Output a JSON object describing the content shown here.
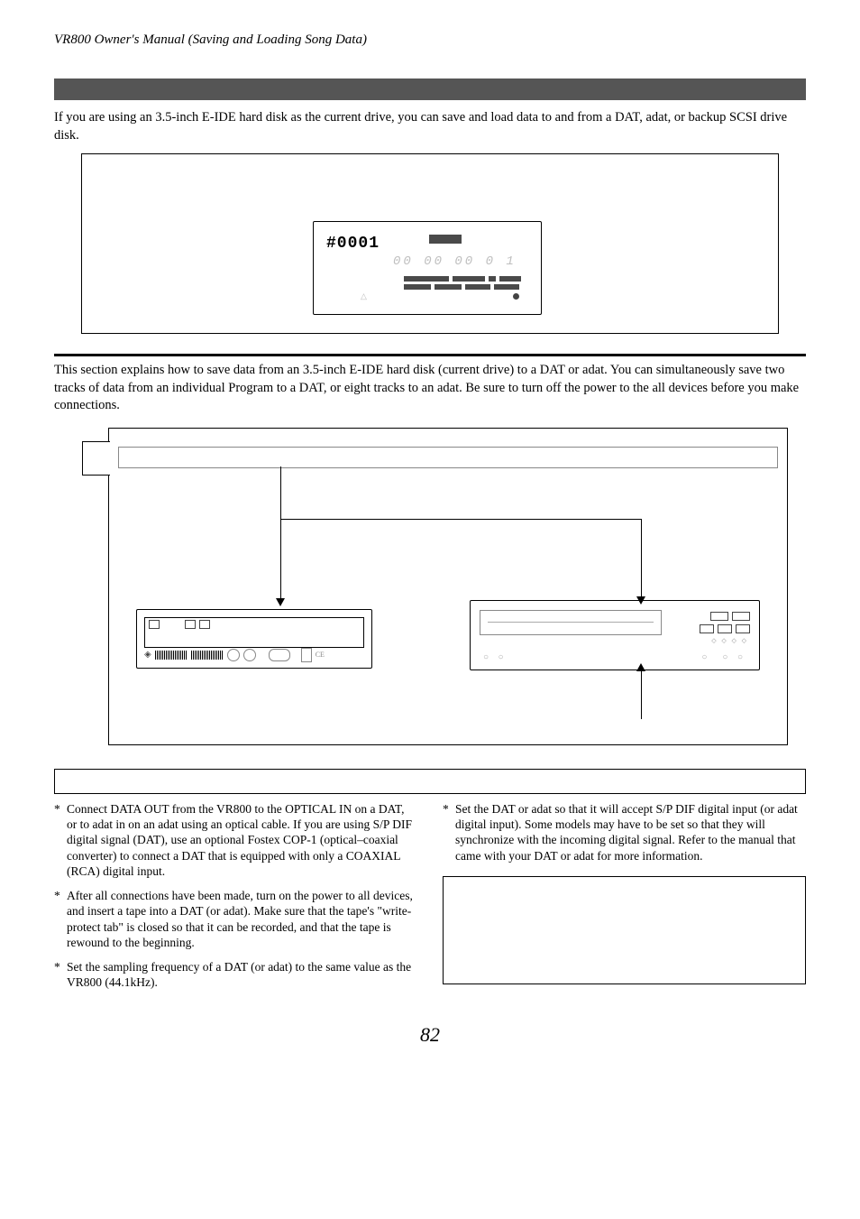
{
  "header": "VR800 Owner's Manual (Saving and Loading Song Data)",
  "intro": "If you are using an 3.5-inch E-IDE hard disk as the current drive, you can save and load data to and from a DAT, adat, or backup SCSI drive disk.",
  "device": {
    "label": "#0001",
    "digits": "00  00  00  0 1"
  },
  "section_intro": "This section explains how to save data from an 3.5-inch E-IDE hard disk (current drive) to a DAT or adat.  You can simultaneously save two tracks of data from an individual Program to a DAT, or eight tracks to an adat.  Be sure to turn off the power to the all devices before you make connections.",
  "left": {
    "b1": "Connect DATA OUT from the VR800 to the OPTICAL IN on a DAT, or to adat in on an adat using an optical cable.  If you are using S/P DIF digital signal (DAT), use an optional Fostex COP-1 (optical–coaxial converter) to connect a DAT that is equipped with only a COAXIAL (RCA) digital input.",
    "b2": "After all connections have been made, turn on the power to all devices, and insert a tape into a DAT (or adat). Make sure that the tape's \"write-protect tab\" is closed so that it can be recorded, and that the tape is rewound to the beginning.",
    "b3": "Set the sampling frequency of a DAT (or adat) to the same value as the VR800 (44.1kHz)."
  },
  "right": {
    "b1": "Set the DAT or adat so that it will accept S/P DIF digital input (or adat digital input). Some models may have to be set so that they will synchronize with the incoming digital signal. Refer to the manual that came with your DAT or adat for more information."
  },
  "pagenum": "82"
}
